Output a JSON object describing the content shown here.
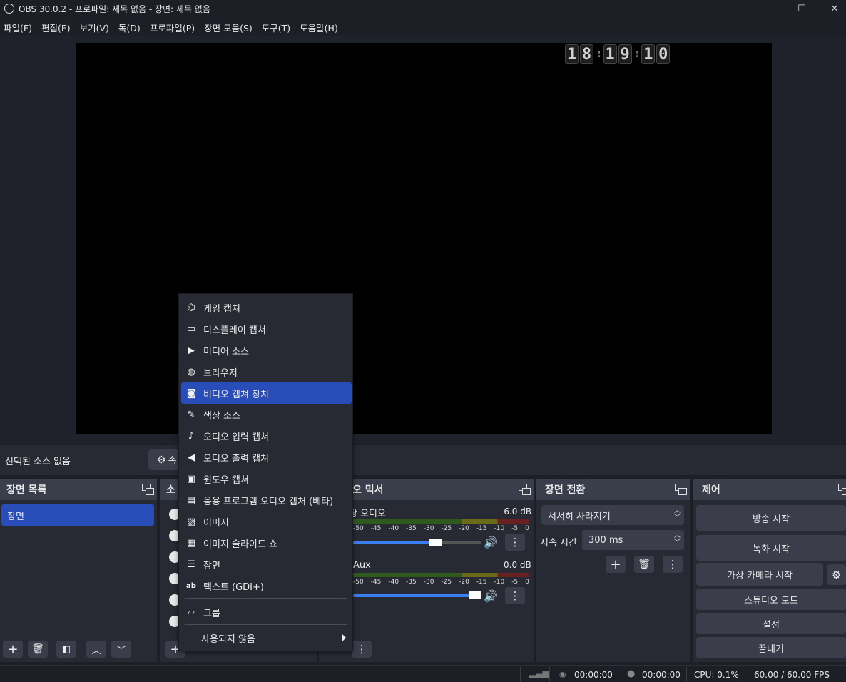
{
  "window": {
    "title": "OBS 30.0.2 - 프로파일: 제목 없음 - 장면: 제목 없음",
    "minimize": "—",
    "maximize": "☐",
    "close": "✕"
  },
  "menubar": [
    "파일(F)",
    "편집(E)",
    "보기(V)",
    "독(D)",
    "프로파일(P)",
    "장면 모음(S)",
    "도구(T)",
    "도움말(H)"
  ],
  "preview": {
    "clock_digits": [
      "1",
      "8",
      "1",
      "9",
      "1",
      "0"
    ]
  },
  "source_toolbar": {
    "no_source": "선택된 소스 없음",
    "properties_label": "속"
  },
  "scenes": {
    "title": "장면 목록",
    "items": [
      "장면"
    ]
  },
  "sources": {
    "title": "소"
  },
  "mixer": {
    "title": "오 믹서",
    "channels": [
      {
        "name": "탕 오디오",
        "db": "-6.0 dB",
        "volume": 0.66
      },
      {
        "name": "Aux",
        "db": "0.0 dB",
        "volume": 1.0
      }
    ],
    "scale": [
      "-50",
      "-45",
      "-40",
      "-35",
      "-30",
      "-25",
      "-20",
      "-15",
      "-10",
      "-5",
      "0"
    ]
  },
  "transitions": {
    "title": "장면 전환",
    "selected": "서서히 사라지기",
    "duration_label": "지속 시간",
    "duration_value": "300 ms"
  },
  "controls": {
    "title": "제어",
    "stream": "방송 시작",
    "record": "녹화 시작",
    "virtual_cam": "가상 카메라 시작",
    "studio": "스튜디오 모드",
    "settings": "설정",
    "exit": "끝내기"
  },
  "statusbar": {
    "stream_time": "00:00:00",
    "record_time": "00:00:00",
    "cpu": "CPU: 0.1%",
    "fps": "60.00 / 60.00 FPS"
  },
  "context_menu": {
    "items": [
      {
        "label": "게임 캡쳐",
        "icon": "gamepad-icon"
      },
      {
        "label": "디스플레이 캡쳐",
        "icon": "monitor-icon"
      },
      {
        "label": "미디어 소스",
        "icon": "play-icon"
      },
      {
        "label": "브라우저",
        "icon": "globe-icon"
      },
      {
        "label": "비디오 캡쳐 장치",
        "icon": "camera-icon",
        "selected": true
      },
      {
        "label": "색상 소스",
        "icon": "brush-icon"
      },
      {
        "label": "오디오 입력 캡쳐",
        "icon": "microphone-icon"
      },
      {
        "label": "오디오 출력 캡쳐",
        "icon": "speaker-icon"
      },
      {
        "label": "윈도우 캡쳐",
        "icon": "window-icon"
      },
      {
        "label": "응용 프로그램 오디오 캡처 (베타)",
        "icon": "app-audio-icon"
      },
      {
        "label": "이미지",
        "icon": "image-icon"
      },
      {
        "label": "이미지 슬라이드 쇼",
        "icon": "slideshow-icon"
      },
      {
        "label": "장면",
        "icon": "list-icon"
      },
      {
        "label": "텍스트 (GDI+)",
        "icon": "text-icon"
      }
    ],
    "group": "그룹",
    "deprecated": "사용되지 않음"
  }
}
